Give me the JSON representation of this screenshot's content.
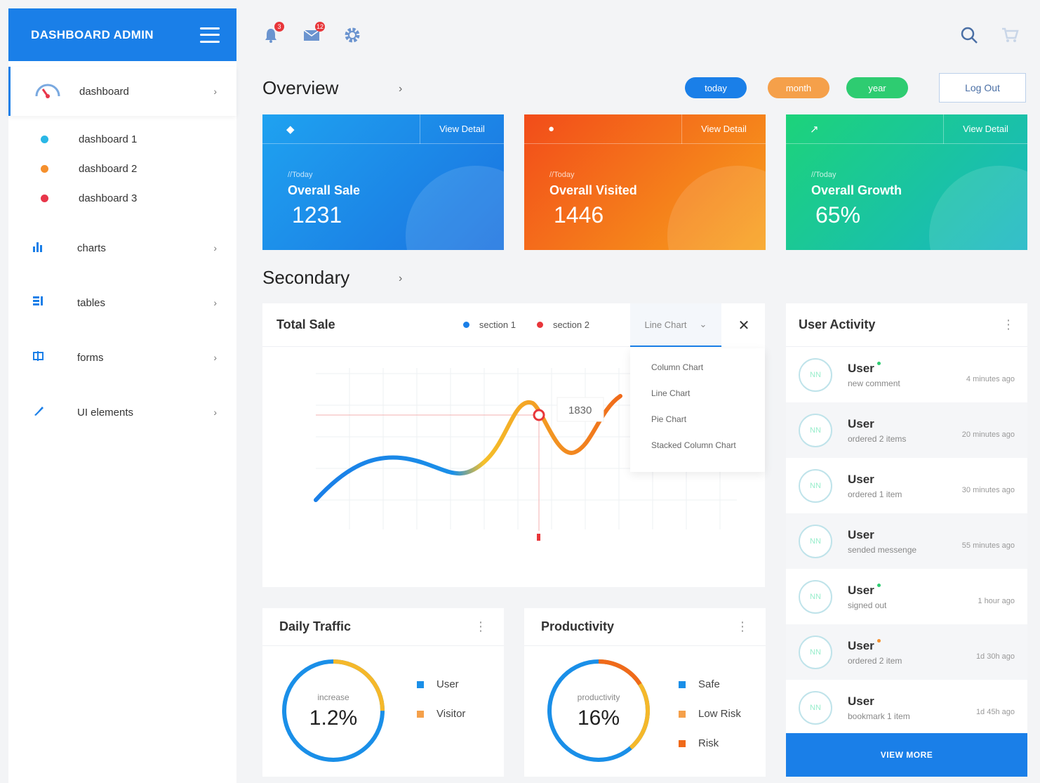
{
  "sidebar": {
    "brand": "DASHBOARD ADMIN",
    "items": [
      {
        "label": "dashboard",
        "icon": "gauge-icon"
      },
      {
        "label": "charts",
        "icon": "bar-chart-icon"
      },
      {
        "label": "tables",
        "icon": "table-icon"
      },
      {
        "label": "forms",
        "icon": "form-icon"
      },
      {
        "label": "UI elements",
        "icon": "brush-icon"
      }
    ],
    "subitems": [
      {
        "label": "dashboard 1",
        "color": "#2ab7e6"
      },
      {
        "label": "dashboard 2",
        "color": "#f5902d"
      },
      {
        "label": "dashboard 3",
        "color": "#e8364a"
      }
    ]
  },
  "topbar": {
    "notifications_count": "3",
    "messages_count": "12"
  },
  "overview": {
    "title": "Overview",
    "filters": [
      {
        "label": "today",
        "color": "#1a7fe8"
      },
      {
        "label": "month",
        "color": "#f5a04a"
      },
      {
        "label": "year",
        "color": "#2ecc71"
      }
    ],
    "logout": "Log Out",
    "cards": [
      {
        "view": "View Detail",
        "small": "//Today",
        "label": "Overall Sale",
        "value": "1231"
      },
      {
        "view": "View Detail",
        "small": "//Today",
        "label": "Overall Visited",
        "value": "1446"
      },
      {
        "view": "View Detail",
        "small": "//Today",
        "label": "Overall Growth",
        "value": "65%"
      }
    ]
  },
  "secondary": {
    "title": "Secondary"
  },
  "total_sale": {
    "title": "Total Sale",
    "legend": [
      "section 1",
      "section 2"
    ],
    "chart_type": "Line Chart",
    "tooltip": "1830",
    "dropdown": [
      "Column Chart",
      "Line Chart",
      "Pie Chart",
      "Stacked Column Chart"
    ]
  },
  "user_activity": {
    "title": "User Activity",
    "rows": [
      {
        "avatar": "NN",
        "name": "User",
        "desc": "new comment",
        "time": "4 minutes ago",
        "dot": "#2ecc71"
      },
      {
        "avatar": "NN",
        "name": "User",
        "desc": "ordered 2 items",
        "time": "20 minutes ago",
        "dot": ""
      },
      {
        "avatar": "NN",
        "name": "User",
        "desc": "ordered 1 item",
        "time": "30 minutes ago",
        "dot": ""
      },
      {
        "avatar": "NN",
        "name": "User",
        "desc": "sended messenge",
        "time": "55 minutes ago",
        "dot": ""
      },
      {
        "avatar": "NN",
        "name": "User",
        "desc": "signed out",
        "time": "1 hour ago",
        "dot": "#2ecc71"
      },
      {
        "avatar": "NN",
        "name": "User",
        "desc": "ordered 2 item",
        "time": "1d 30h ago",
        "dot": "#f5902d"
      },
      {
        "avatar": "NN",
        "name": "User",
        "desc": "bookmark 1 item",
        "time": "1d 45h ago",
        "dot": ""
      }
    ],
    "view_more": "VIEW MORE"
  },
  "daily_traffic": {
    "title": "Daily Traffic",
    "small": "increase",
    "value": "1.2%",
    "legend": [
      {
        "label": "User",
        "color": "#1a8fe8"
      },
      {
        "label": "Visitor",
        "color": "#f5a04a"
      }
    ]
  },
  "productivity": {
    "title": "Productivity",
    "small": "productivity",
    "value": "16%",
    "legend": [
      {
        "label": "Safe",
        "color": "#1a8fe8"
      },
      {
        "label": "Low Risk",
        "color": "#f5a04a"
      },
      {
        "label": "Risk",
        "color": "#f06a1a"
      }
    ]
  }
}
